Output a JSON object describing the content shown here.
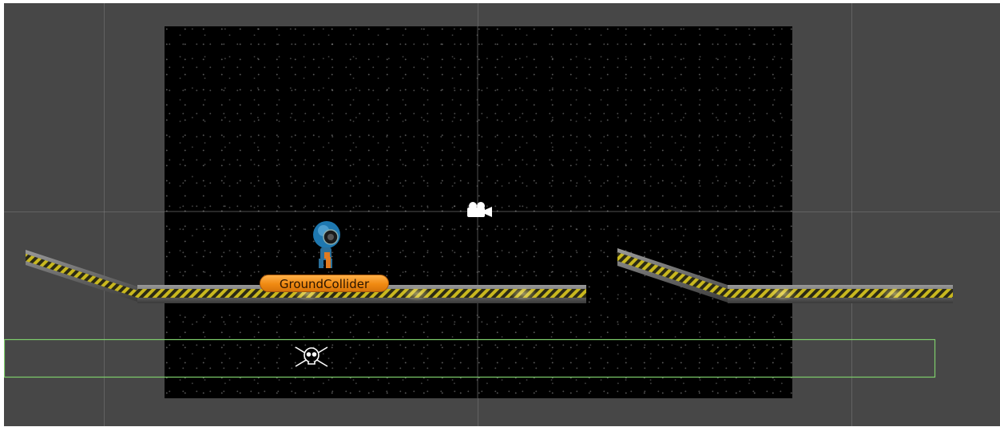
{
  "scene": {
    "selected_object_label": "GroundCollider",
    "icons": {
      "camera": "camera-gizmo-icon",
      "kill_zone": "skull-crossbones-icon",
      "player": "player-robot-sprite"
    },
    "colors": {
      "scene_background": "#474747",
      "game_view_background": "#000000",
      "label_fill": "#f08a12",
      "collider_outline": "#7fcf6c",
      "platform_hazard_yellow": "#d4c020"
    }
  }
}
